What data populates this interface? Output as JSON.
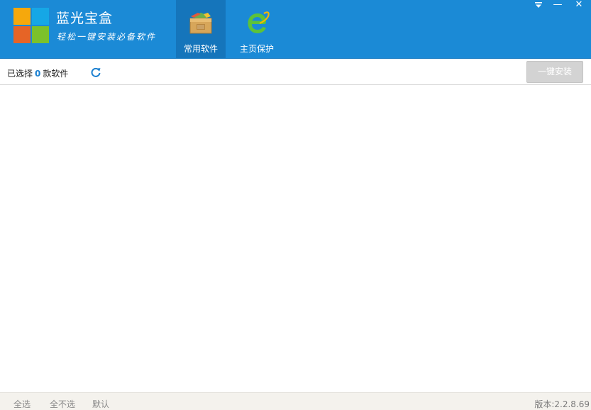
{
  "app": {
    "title": "蓝光宝盒",
    "slogan": "轻松一键安装必备软件"
  },
  "tabs": [
    {
      "label": "常用软件",
      "icon": "software-box-icon",
      "active": true
    },
    {
      "label": "主页保护",
      "icon": "ie-browser-icon",
      "active": false
    }
  ],
  "window_controls": {
    "menu_icon": "dropdown-menu-icon",
    "minimize_symbol": "—",
    "close_symbol": "✕"
  },
  "toolbar": {
    "selected_prefix": "已选择",
    "selected_count": "0",
    "selected_suffix": "款软件",
    "refresh_icon": "refresh-icon",
    "install_label": "一键安装"
  },
  "footer": {
    "select_all": "全选",
    "select_none": "全不选",
    "default": "默认",
    "version": "版本:2.2.8.69"
  },
  "colors": {
    "header_blue": "#1b8ad6",
    "active_tab": "#1575bb",
    "count_blue": "#1a7fd0",
    "install_disabled": "#d3d3d3"
  }
}
